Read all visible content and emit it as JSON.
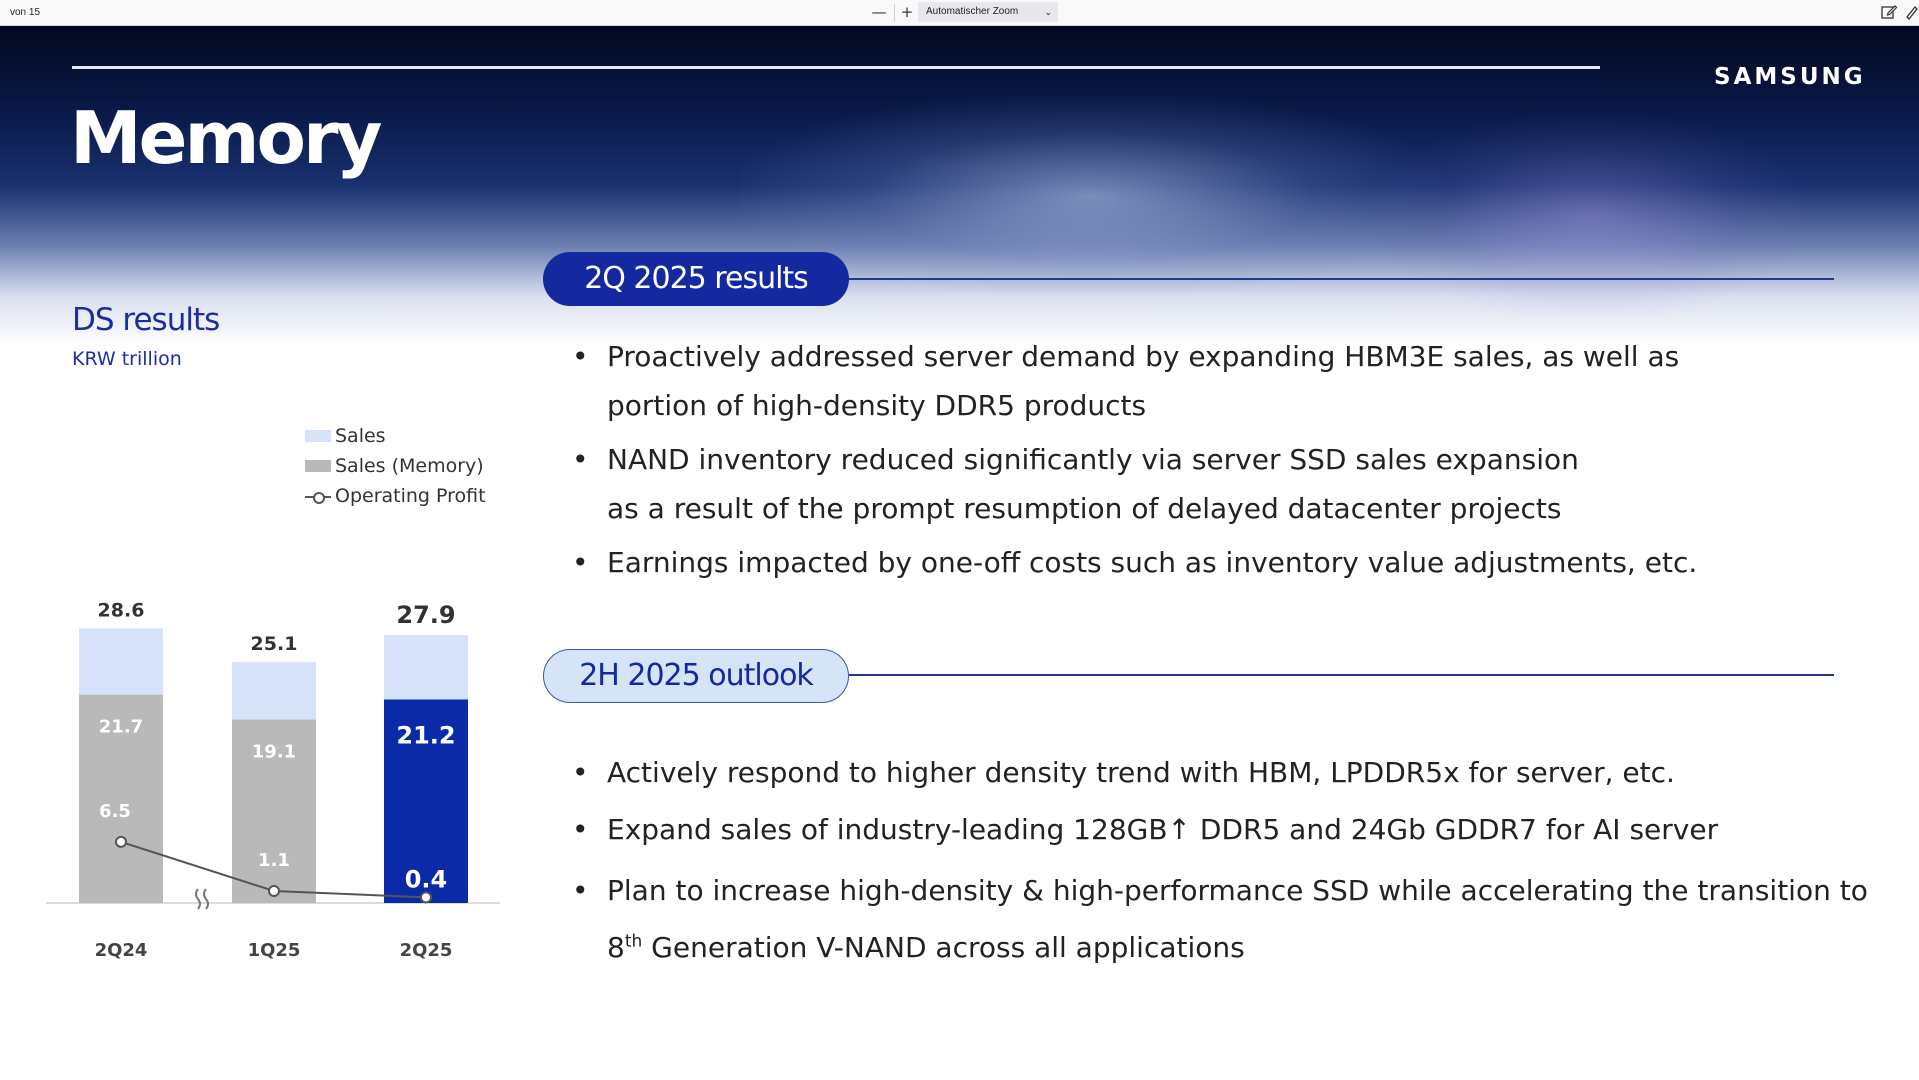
{
  "viewer": {
    "page_label": "von 15",
    "zoom_out": "—",
    "zoom_in": "+",
    "zoom_value": "Automatischer Zoom"
  },
  "slide": {
    "title": "Memory",
    "logo": "SAMSUNG",
    "left": {
      "heading": "DS results",
      "unit": "KRW trillion"
    },
    "results": {
      "label": "2Q 2025 results",
      "bullets": [
        "Proactively addressed server demand by expanding HBM3E sales, as well as",
        "portion of high-density DDR5 products",
        "NAND inventory reduced significantly via server SSD sales expansion",
        "as a result of the prompt resumption of delayed datacenter projects",
        "Earnings impacted by one-off costs such as inventory value adjustments, etc."
      ]
    },
    "outlook": {
      "label": "2H 2025 outlook",
      "bullets": [
        "Actively respond to higher density trend with HBM, LPDDR5x for server, etc.",
        "Expand sales of industry-leading 128GB↑ DDR5 and 24Gb GDDR7 for AI server",
        "Plan to increase high-density & high-performance SSD while accelerating the transition to",
        "8",
        "th",
        " Generation V-NAND across all applications"
      ]
    }
  },
  "colors": {
    "accent": "#1428a0",
    "sales": "#d6e2f7",
    "memory": "#b9b9b9",
    "highlight": "#0a2aa8",
    "line": "#555555"
  },
  "chart_data": {
    "type": "bar",
    "categories": [
      "2Q24",
      "1Q25",
      "2Q25"
    ],
    "series": [
      {
        "name": "Sales",
        "values": [
          28.6,
          25.1,
          27.9
        ]
      },
      {
        "name": "Sales (Memory)",
        "values": [
          21.7,
          19.1,
          21.2
        ]
      },
      {
        "name": "Operating Profit",
        "values": [
          6.5,
          1.1,
          0.4
        ],
        "type": "line"
      }
    ],
    "axis_break_between": [
      "2Q24",
      "1Q25"
    ],
    "highlight_category": "2Q25",
    "legend": "top-right",
    "grid": false
  }
}
